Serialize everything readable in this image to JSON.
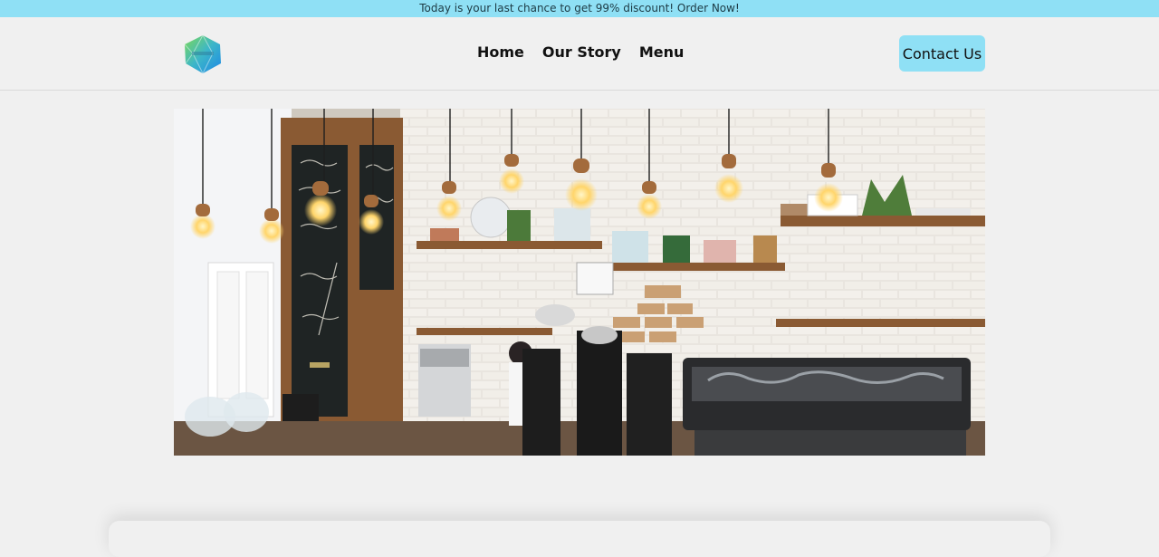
{
  "announcement": {
    "text": "Today is your last chance to get 99% discount! Order Now!"
  },
  "header": {
    "logo_icon": "hexagon-logo-icon",
    "nav": [
      {
        "label": "Home"
      },
      {
        "label": "Our Story"
      },
      {
        "label": "Menu"
      }
    ],
    "contact_label": "Contact Us"
  },
  "hero": {
    "image": "coffee-shop-interior-photo",
    "chalkboard_lines": [
      "Coffee",
      "Bread",
      "Espresso"
    ]
  },
  "colors": {
    "accent": "#8fe0f5",
    "background": "#f0f0f0"
  }
}
